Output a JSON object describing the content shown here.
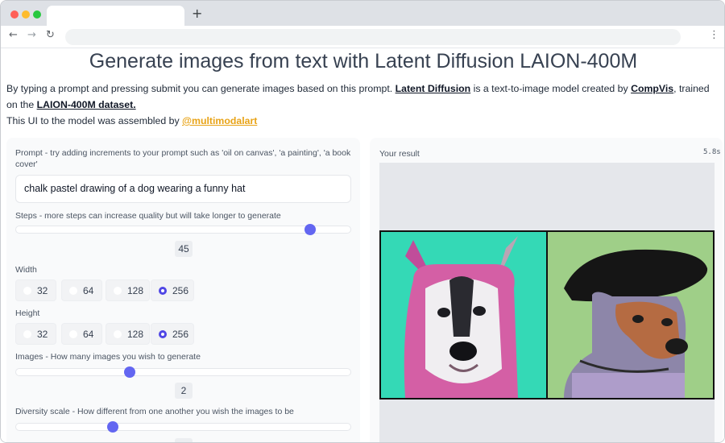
{
  "page": {
    "title": "Generate images from text with Latent Diffusion LAION-400M",
    "intro": {
      "text1": "By typing a prompt and pressing submit you can generate images based on this prompt. ",
      "link1": "Latent Diffusion",
      "text2": " is a text-to-image model created by ",
      "link2": "CompVis",
      "text3": ", trained on the ",
      "link3": "LAION-400M dataset.",
      "text4": "This UI to the model was assembled by ",
      "link4": "@multimodalart"
    }
  },
  "form": {
    "prompt_label": "Prompt - try adding increments to your prompt such as 'oil on canvas', 'a painting', 'a book cover'",
    "prompt_value": "chalk pastel drawing of a dog wearing a funny hat",
    "steps_label": "Steps - more steps can increase quality but will take longer to generate",
    "steps_value": "45",
    "steps_fraction": 0.88,
    "width_label": "Width",
    "width_options": [
      "32",
      "64",
      "128",
      "256"
    ],
    "width_selected": "256",
    "height_label": "Height",
    "height_options": [
      "32",
      "64",
      "128",
      "256"
    ],
    "height_selected": "256",
    "images_label": "Images - How many images you wish to generate",
    "images_value": "2",
    "images_fraction": 0.34,
    "diversity_label": "Diversity scale - How different from one another you wish the images to be",
    "diversity_fraction": 0.29
  },
  "result": {
    "label": "Your result",
    "time": "5.8s",
    "images": [
      {
        "icon": "dog-portrait-pink-fur"
      },
      {
        "icon": "dog-portrait-black-beret"
      }
    ]
  },
  "colors": {
    "accent": "#6366f1",
    "link_orange": "#e8a317"
  }
}
